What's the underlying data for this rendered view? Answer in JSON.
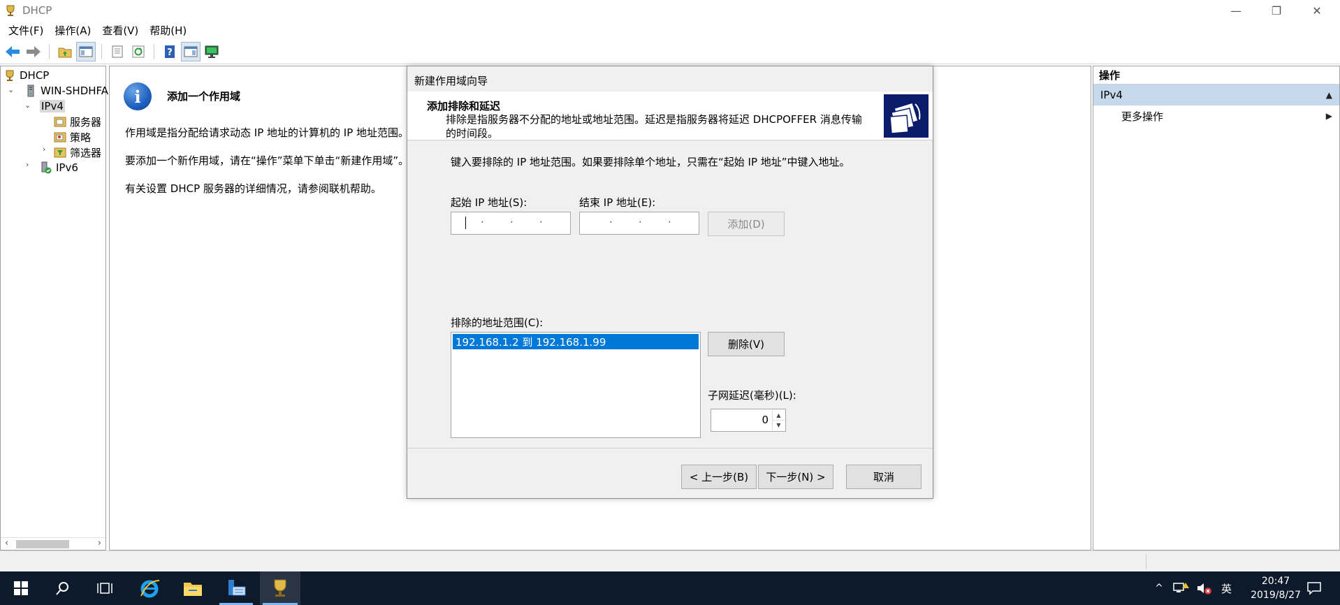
{
  "window": {
    "title": "DHCP",
    "controls": {
      "minimize": "—",
      "restore": "❐",
      "close": "✕"
    }
  },
  "menu": [
    "文件(F)",
    "操作(A)",
    "查看(V)",
    "帮助(H)"
  ],
  "toolbar_icons": [
    "back-arrow-icon",
    "forward-arrow-icon",
    "up-folder-icon",
    "show-hide-tree-icon",
    "properties-icon",
    "refresh-icon",
    "help-icon",
    "show-hide-action-pane-icon",
    "monitor-icon"
  ],
  "tree": {
    "root": "DHCP",
    "server": "WIN-SHDHFA",
    "ipv4": "IPv4",
    "children": [
      "服务器",
      "策略",
      "筛选器"
    ],
    "ipv6": "IPv6"
  },
  "main": {
    "title": "添加一个作用域",
    "paragraphs": [
      "作用域是指分配给请求动态 IP 地址的计算机的 IP 地址范围。你",
      "要添加一个新作用域，请在“操作”菜单下单击“新建作用域”。",
      "有关设置 DHCP 服务器的详细情况，请参阅联机帮助。"
    ]
  },
  "actions": {
    "header": "操作",
    "section": "IPv4",
    "more": "更多操作"
  },
  "dialog": {
    "title": "新建作用域向导",
    "heading": "添加排除和延迟",
    "subheading": "排除是指服务器不分配的地址或地址范围。延迟是指服务器将延迟 DHCPOFFER 消息传输的时间段。",
    "instruction": "键入要排除的 IP 地址范围。如果要排除单个地址，只需在“起始 IP 地址”中键入地址。",
    "start_ip_label": "起始 IP 地址(S):",
    "end_ip_label": "结束 IP 地址(E):",
    "add_button": "添加(D)",
    "excluded_label": "排除的地址范围(C):",
    "excluded_items": [
      "192.168.1.2 到 192.168.1.99"
    ],
    "remove_button": "删除(V)",
    "delay_label": "子网延迟(毫秒)(L):",
    "delay_value": "0",
    "back_button": "< 上一步(B)",
    "next_button": "下一步(N) >",
    "cancel_button": "取消"
  },
  "taskbar": {
    "tray_lang": "英",
    "time": "20:47",
    "date": "2019/8/27"
  }
}
